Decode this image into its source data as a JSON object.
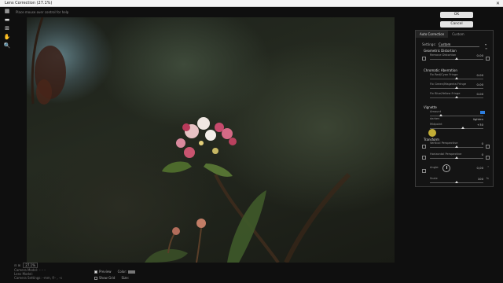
{
  "window": {
    "title": "Lens Correction (27.1%)",
    "close_label": "✕"
  },
  "hint": "Place mouse over control for help",
  "tools": [
    {
      "name": "remove-distortion-tool-icon",
      "glyph": "▦"
    },
    {
      "name": "straighten-tool-icon",
      "glyph": "▬"
    },
    {
      "name": "move-grid-tool-icon",
      "glyph": "⊞"
    },
    {
      "name": "hand-tool-icon",
      "glyph": "✋"
    },
    {
      "name": "zoom-tool-icon",
      "glyph": "🔍"
    }
  ],
  "buttons": {
    "ok": "OK",
    "cancel": "Cancel"
  },
  "tabs": [
    {
      "label": "Auto Correction",
      "active": true
    },
    {
      "label": "Custom",
      "active": false
    }
  ],
  "settings": {
    "label": "Settings:",
    "value": "Custom",
    "menu": "▾ ≡"
  },
  "sections": {
    "geometric": "Geometric Distortion",
    "chromatic": "Chromatic Aberration",
    "vignette": "Vignette",
    "transform": "Transform"
  },
  "controls": {
    "remove_distortion": {
      "label": "Remove Distortion",
      "value": "0.00",
      "pos": 0.5
    },
    "fix_red_cyan": {
      "label": "Fix Red/Cyan Fringe",
      "value": "0.00",
      "pos": 0.5
    },
    "fix_green_magenta": {
      "label": "Fix Green/Magenta Fringe",
      "value": "0.00",
      "pos": 0.5
    },
    "fix_blue_yellow": {
      "label": "Fix Blue/Yellow Fringe",
      "value": "0.00",
      "pos": 0.5
    },
    "amount": {
      "label": "Amount",
      "value": "",
      "pos": 0.2
    },
    "darken": {
      "label": "darken",
      "value": "lighten",
      "pos": null
    },
    "midpoint": {
      "label": "Midpoint",
      "value": "+30",
      "pos": 0.62
    },
    "vertical_perspective": {
      "label": "Vertical Perspective",
      "value": "0",
      "pos": 0.5
    },
    "horizontal_perspective": {
      "label": "Horizontal Perspective",
      "value": "0",
      "pos": 0.5
    },
    "angle": {
      "label": "Angle:",
      "value": "0,00",
      "unit": "°"
    },
    "scale": {
      "label": "Scale",
      "value": "100",
      "unit": "%",
      "pos": 0.5
    }
  },
  "zoom": {
    "level": "27.1%"
  },
  "camera_info": [
    "Camera Model: – – –",
    "Lens Model:",
    "Camera Settings: –mm, f/– , –s"
  ],
  "options": {
    "preview_label": "Preview",
    "preview_checked": true,
    "color_label": "Color:",
    "show_grid_label": "Show Grid",
    "show_grid_checked": false,
    "size_label": "Size:"
  },
  "colors": {
    "accent": "#2d7fe0",
    "button": "#e4e4e4"
  }
}
